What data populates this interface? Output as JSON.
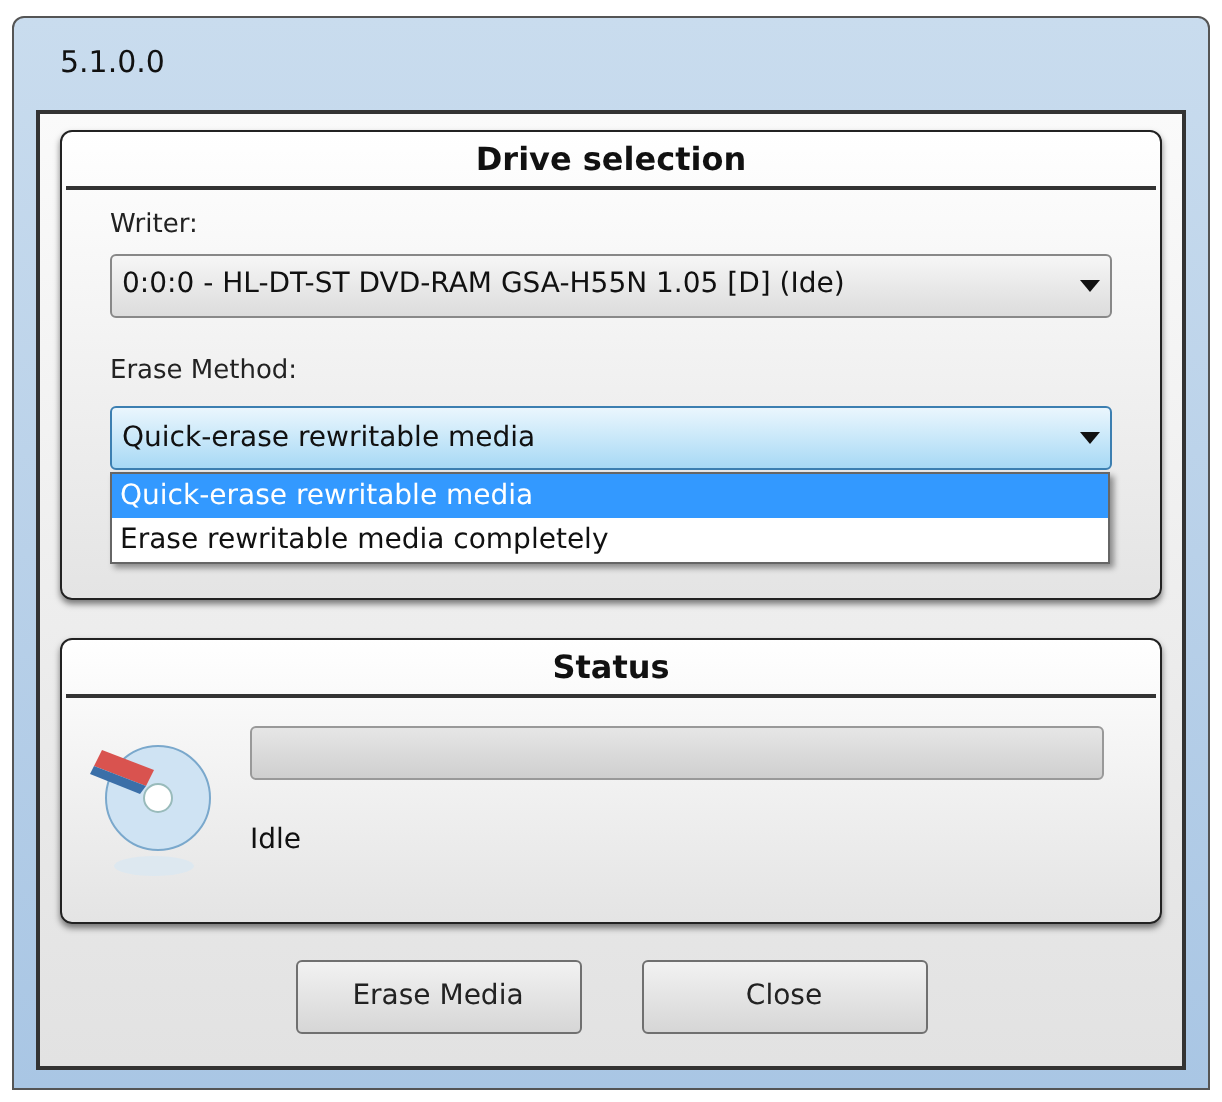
{
  "window": {
    "title": "5.1.0.0"
  },
  "drive_selection": {
    "heading": "Drive selection",
    "writer": {
      "label": "Writer:",
      "value": "0:0:0 - HL-DT-ST DVD-RAM GSA-H55N 1.05 [D] (Ide)"
    },
    "erase_method": {
      "label": "Erase Method:",
      "value": "Quick-erase rewritable media",
      "expanded": true,
      "options": [
        {
          "label": "Quick-erase rewritable media",
          "selected": true
        },
        {
          "label": "Erase rewritable media completely",
          "selected": false
        }
      ]
    }
  },
  "status": {
    "heading": "Status",
    "progress": {
      "level": 0
    },
    "text": "Idle"
  },
  "buttons": [
    "Erase Media",
    "Close"
  ]
}
